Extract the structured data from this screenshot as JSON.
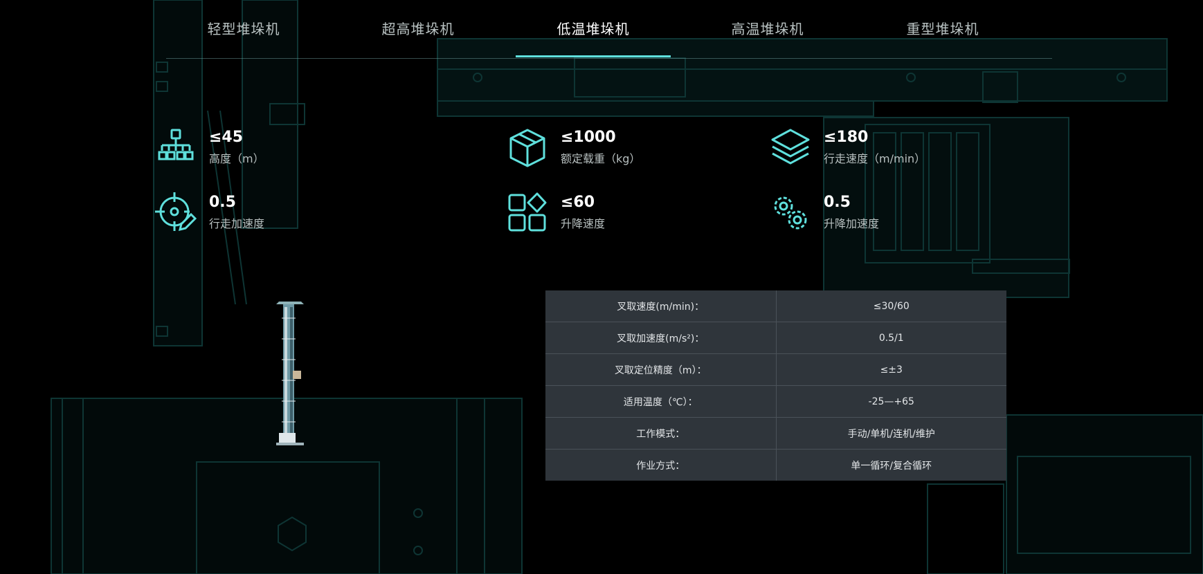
{
  "tabs": [
    {
      "label": "轻型堆垛机",
      "active": false
    },
    {
      "label": "超高堆垛机",
      "active": false
    },
    {
      "label": "低温堆垛机",
      "active": true
    },
    {
      "label": "高温堆垛机",
      "active": false
    },
    {
      "label": "重型堆垛机",
      "active": false
    }
  ],
  "stats": [
    {
      "value": "≤45",
      "label": "高度（m）",
      "icon": "org-chart-icon"
    },
    {
      "value": "≤1000",
      "label": "额定载重（kg）",
      "icon": "cube-icon"
    },
    {
      "value": "≤180",
      "label": "行走速度（m/min）",
      "icon": "layers-icon"
    },
    {
      "value": "0.5",
      "label": "行走加速度",
      "icon": "target-edit-icon"
    },
    {
      "value": "≤60",
      "label": "升降速度",
      "icon": "apps-grid-icon"
    },
    {
      "value": "0.5",
      "label": "升降加速度",
      "icon": "gears-icon"
    }
  ],
  "specs": [
    {
      "name": "叉取速度(m/min)：",
      "value": "≤30/60"
    },
    {
      "name": "叉取加速度(m/s²)：",
      "value": "0.5/1"
    },
    {
      "name": "叉取定位精度（m）：",
      "value": "≤±3"
    },
    {
      "name": "适用温度（℃）：",
      "value": "-25—+65"
    },
    {
      "name": "工作模式：",
      "value": "手动/单机/连机/维护"
    },
    {
      "name": "作业方式：",
      "value": "单一循环/复合循环"
    }
  ],
  "colors": {
    "accent": "#5fe0dd",
    "background": "#000000",
    "table_bg": "#2f353b"
  }
}
